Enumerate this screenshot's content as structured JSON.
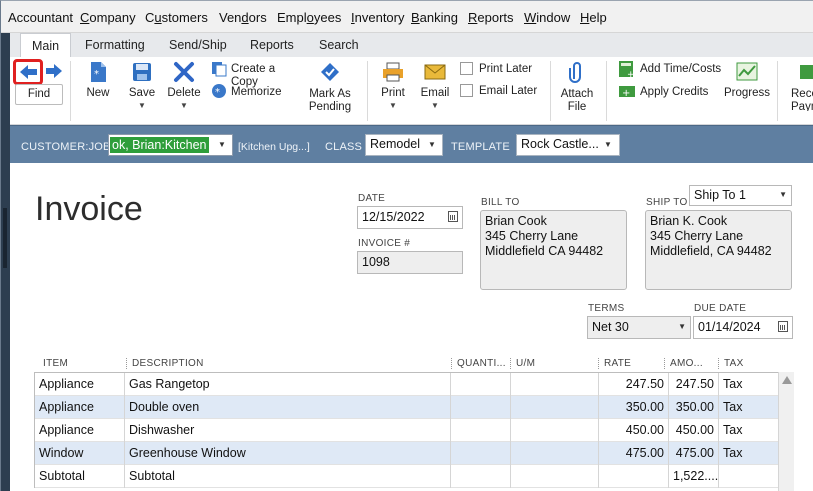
{
  "menu": [
    "Accountant",
    "Company",
    "Customers",
    "Vendors",
    "Employees",
    "Inventory",
    "Banking",
    "Reports",
    "Window",
    "Help"
  ],
  "menu_underline": [
    "",
    "C",
    "u",
    "d",
    "o",
    "I",
    "B",
    "R",
    "W",
    "H"
  ],
  "tabs": [
    "Main",
    "Formatting",
    "Send/Ship",
    "Reports",
    "Search"
  ],
  "ribbon": {
    "find": "Find",
    "new": "New",
    "save": "Save",
    "delete": "Delete",
    "create_copy": "Create a Copy",
    "memorize": "Memorize",
    "mark_as_pending_1": "Mark As",
    "mark_as_pending_2": "Pending",
    "print": "Print",
    "email": "Email",
    "print_later": "Print Later",
    "email_later": "Email Later",
    "attach_1": "Attach",
    "attach_2": "File",
    "add_time_costs": "Add Time/Costs",
    "apply_credits": "Apply Credits",
    "progress": "Progress",
    "receive_1": "Rece",
    "receive_2": "Paym"
  },
  "customer_bar": {
    "customer_job_label": "CUSTOMER:JOB",
    "customer_job_value": "ok, Brian:Kitchen",
    "job_desc": "[Kitchen Upg...]",
    "class_label": "CLASS",
    "class_value": "Remodel",
    "template_label": "TEMPLATE",
    "template_value": "Rock Castle..."
  },
  "invoice": {
    "title": "Invoice",
    "date_label": "DATE",
    "date_value": "12/15/2022",
    "invoice_no_label": "INVOICE #",
    "invoice_no_value": "1098",
    "bill_to_label": "BILL TO",
    "bill_to": [
      "Brian Cook",
      "345 Cherry Lane",
      "Middlefield CA 94482"
    ],
    "ship_to_label": "SHIP TO",
    "ship_to_select": "Ship To 1",
    "ship_to": [
      "Brian K. Cook",
      "345 Cherry Lane",
      "Middlefield, CA 94482"
    ],
    "terms_label": "TERMS",
    "terms_value": "Net 30",
    "due_date_label": "DUE DATE",
    "due_date_value": "01/14/2024"
  },
  "table": {
    "headers": [
      "ITEM",
      "DESCRIPTION",
      "QUANTI...",
      "U/M",
      "RATE",
      "AMO...",
      "TAX"
    ],
    "rows": [
      {
        "item": "Appliance",
        "description": "Gas Rangetop",
        "qty": "",
        "um": "",
        "rate": "247.50",
        "amount": "247.50",
        "tax": "Tax"
      },
      {
        "item": "Appliance",
        "description": "Double oven",
        "qty": "",
        "um": "",
        "rate": "350.00",
        "amount": "350.00",
        "tax": "Tax"
      },
      {
        "item": "Appliance",
        "description": "Dishwasher",
        "qty": "",
        "um": "",
        "rate": "450.00",
        "amount": "450.00",
        "tax": "Tax"
      },
      {
        "item": "Window",
        "description": "Greenhouse Window",
        "qty": "",
        "um": "",
        "rate": "475.00",
        "amount": "475.00",
        "tax": "Tax"
      },
      {
        "item": "Subtotal",
        "description": "Subtotal",
        "qty": "",
        "um": "",
        "rate": "",
        "amount": "1,522....",
        "tax": ""
      }
    ]
  },
  "colors": {
    "accent_blue": "#5f7fa1",
    "highlight_green": "#2e9e3a",
    "find_highlight": "#e02020"
  }
}
